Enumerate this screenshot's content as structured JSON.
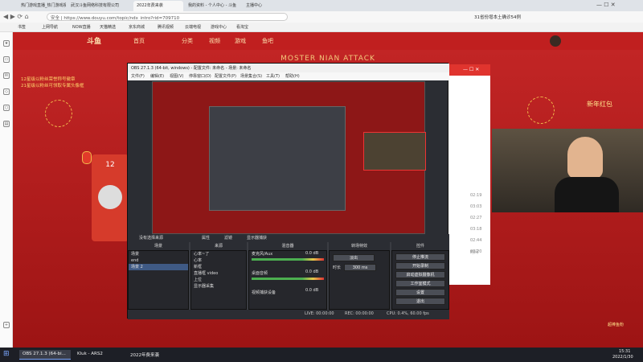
{
  "browser": {
    "tabs": [
      {
        "label": "热门游戏直播_热门游戏视频_热门..."
      },
      {
        "label": "武汉斗鱼网络科技有限公司"
      },
      {
        "label": "2022年费来袭"
      },
      {
        "label": "我的资料 - 个人中心 - 斗鱼"
      },
      {
        "label": "主播中心"
      }
    ],
    "address": "安全 | https://www.douyu.com/topic/ndx_intro?rid=709710",
    "address_right": "31省份增本土确诊54例",
    "bookmarks": [
      "书签",
      "上网导航",
      "NOW直播",
      "天猫精选",
      "京东商城",
      "腾讯视频",
      "云端电视",
      "游戏中心",
      "看淘宝"
    ]
  },
  "site": {
    "logo": "斗鱼",
    "nav": [
      "首页",
      "分类",
      "视频",
      "游戏",
      "鱼吧"
    ],
    "banner": "MOSTER NIAN ATTACK",
    "promo_line1": "12星级以粉丝荣誉称号徽章",
    "promo_line2": "21星级以粉丝可领取专属头像框",
    "counter": "12",
    "new_year_badge": "新年红包",
    "right_label": "时间",
    "times": [
      "02:19",
      "03:03",
      "02:27",
      "03:18",
      "02:44",
      "02:20"
    ],
    "corner_badge": "超棒鱼粉"
  },
  "obs": {
    "title": "OBS 27.1.3 (64-bit, windows) - 配置文件: 未命名 - 场景: 未命名",
    "menu": [
      "文件(F)",
      "编辑(E)",
      "视图(V)",
      "停靠窗口(D)",
      "配置文件(P)",
      "场景集合(S)",
      "工具(T)",
      "帮助(H)"
    ],
    "source_bar": [
      "没有选择来源",
      "属性",
      "滤镜",
      "显示器捕获"
    ],
    "docks": {
      "scenes": {
        "header": "场景",
        "items": [
          "场景",
          "end",
          "场景 2"
        ]
      },
      "sources": {
        "header": "来源",
        "items": [
          "心率~了",
          "心率",
          "新框",
          "直播框 video",
          "上位",
          "显示器采集"
        ]
      },
      "mixer": {
        "header": "混音器",
        "channels": [
          {
            "name": "麦克风/Aux",
            "level": "0.0 dB"
          },
          {
            "name": "桌面音频",
            "level": "0.0 dB"
          },
          {
            "name": "视频捕获设备",
            "level": "0.0 dB"
          }
        ]
      },
      "transitions": {
        "header": "转场特效",
        "type": "淡出",
        "duration_label": "时长",
        "duration": "300 ms"
      },
      "controls": {
        "header": "控件",
        "buttons": [
          "停止推流",
          "开始录制",
          "启动虚拟摄像机",
          "工作室模式",
          "设置",
          "退出"
        ]
      }
    },
    "status": {
      "live": "LIVE: 00:00:00",
      "rec": "REC: 00:00:00",
      "cpu": "CPU: 0.4%, 60.00 fps"
    }
  },
  "taskbar": {
    "items": [
      {
        "label": "OBS 27.1.3 (64-bi..."
      },
      {
        "label": "Kluk - ARS2"
      },
      {
        "label": "2022年费来袭"
      }
    ],
    "time": "15:31",
    "date": "2022/1/30"
  },
  "colors": {
    "site_red": "#c42626",
    "obs_bg": "#2b2d33",
    "taskbar": "#1d1f26"
  }
}
